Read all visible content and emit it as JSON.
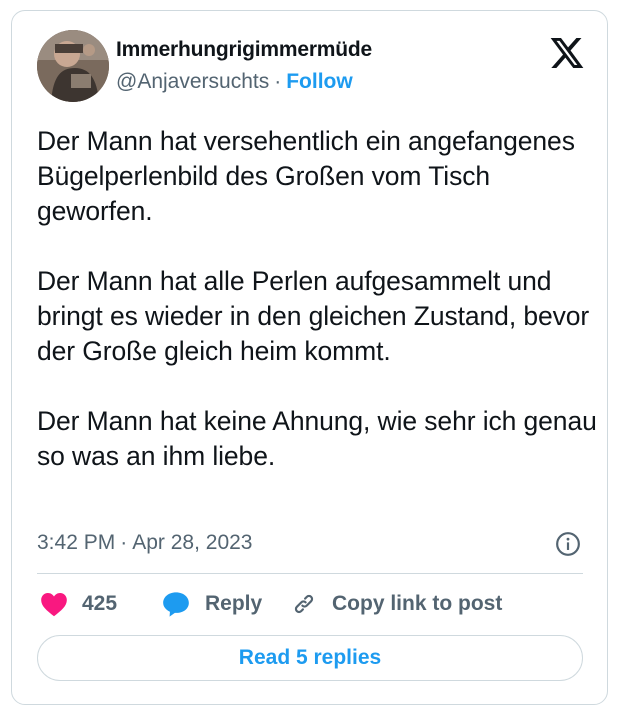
{
  "author": {
    "display_name": "Immerhungrigimmermüde",
    "handle": "@Anjaversuchts",
    "separator": "·",
    "follow_label": "Follow"
  },
  "tweet": {
    "paragraphs": [
      "Der Mann hat versehentlich ein angefangenes Bügelperlenbild des Großen vom Tisch geworfen.",
      "Der Mann hat alle Perlen aufgesammelt und bringt es wieder in den gleichen Zustand, bevor der Große gleich heim kommt.",
      "Der Mann hat keine Ahnung, wie sehr ich genau so was an ihm liebe."
    ],
    "time": "3:42 PM",
    "separator": "·",
    "date": "Apr 28, 2023"
  },
  "actions": {
    "like_count": "425",
    "reply_label": "Reply",
    "copy_link_label": "Copy link to post"
  },
  "read_replies_label": "Read 5 replies",
  "colors": {
    "accent": "#1d9bf0",
    "like": "#f91880",
    "muted": "#536471",
    "border": "#cfd9de"
  },
  "icons": [
    "x-logo-icon",
    "info-icon",
    "heart-icon",
    "reply-bubble-icon",
    "link-icon"
  ]
}
